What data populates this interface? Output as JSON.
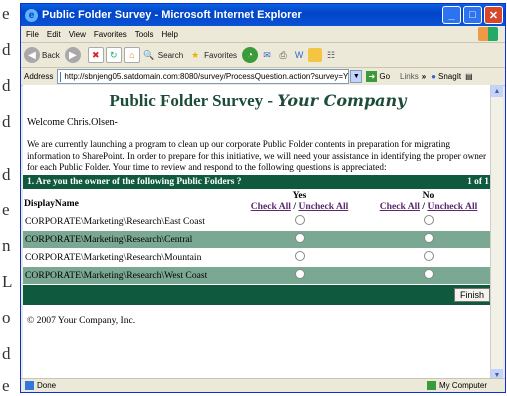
{
  "edge_letters": [
    "e",
    "d",
    "d",
    "d",
    "d",
    "e",
    "n",
    "L",
    "o",
    "d",
    "e"
  ],
  "window": {
    "title": "Public Folder Survey - Microsoft Internet Explorer"
  },
  "menu": [
    "File",
    "Edit",
    "View",
    "Favorites",
    "Tools",
    "Help"
  ],
  "toolbar": {
    "back": "Back",
    "search": "Search",
    "favorites": "Favorites"
  },
  "address": {
    "label": "Address",
    "url": "http://sbnjeng05.satdomain.com:8080/survey/ProcessQuestion.action?survey=Y",
    "go": "Go",
    "links": "Links",
    "snagit": "SnagIt"
  },
  "page": {
    "title": "Public Folder Survey - ",
    "logo": "Your Company",
    "welcome": "Welcome Chris.Olsen-",
    "intro": "We are currently launching a program to clean up our corporate Public Folder contents in preparation for migrating information to SharePoint. In order to prepare for this initiative, we will need your assistance in identifying the proper owner for each Public Folder. Your time to review and respond to the following questions is appreciated:",
    "question": "1. Are you the owner of the following Public Folders ?",
    "page_indicator": "1 of 1",
    "col_name": "DisplayName",
    "col_yes": "Yes",
    "col_no": "No",
    "check_all": "Check All",
    "separator": "/",
    "uncheck_all": "Uncheck All",
    "rows": [
      "CORPORATE\\Marketing\\Research\\East Coast",
      "CORPORATE\\Marketing\\Research\\Central",
      "CORPORATE\\Marketing\\Research\\Mountain",
      "CORPORATE\\Marketing\\Research\\West Coast"
    ],
    "finish": "Finish",
    "copyright": "© 2007 Your Company, Inc."
  },
  "status": {
    "left": "Done",
    "right": "My Computer"
  }
}
